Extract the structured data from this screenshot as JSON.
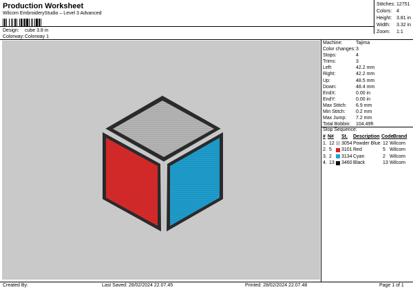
{
  "header": {
    "title": "Production Worksheet",
    "subtitle": "Wilcom EmbroideryStudio – Level 3 Advanced",
    "design_label": "Design:",
    "design_value": "cube 3.8 in",
    "colorway_label": "Colorway:",
    "colorway_value": "Colorway 1"
  },
  "top_stats": [
    {
      "label": "Stitches:",
      "value": "12751"
    },
    {
      "label": "Colors:",
      "value": "4"
    },
    {
      "label": "Height:",
      "value": "3.81 in"
    },
    {
      "label": "Width:",
      "value": "3.32 in"
    },
    {
      "label": "Zoom:",
      "value": "1:1"
    }
  ],
  "machine_info": [
    {
      "label": "Machine:",
      "value": "Tajima"
    },
    {
      "label": "Color changes:",
      "value": "3"
    },
    {
      "label": "Stops:",
      "value": "4"
    },
    {
      "label": "Trims:",
      "value": "3"
    },
    {
      "label": "Left:",
      "value": "42.2 mm"
    },
    {
      "label": "Right:",
      "value": "42.2 mm"
    },
    {
      "label": "Up:",
      "value": "48.5 mm"
    },
    {
      "label": "Down:",
      "value": "48.4 mm"
    },
    {
      "label": "EndX:",
      "value": "0.00 in"
    },
    {
      "label": "EndY:",
      "value": "0.00 in"
    },
    {
      "label": "Max Stitch:",
      "value": "6.9 mm"
    },
    {
      "label": "Min Stitch:",
      "value": "0.2 mm"
    },
    {
      "label": "Max Jump:",
      "value": "7.2 mm"
    },
    {
      "label": "Total Bobbin:",
      "value": "104.49ft"
    }
  ],
  "stop_sequence": {
    "title": "Stop Sequence:",
    "headers": {
      "num": "#",
      "st": "N#",
      "code": "St.",
      "desc": "Description",
      "code2": "Code",
      "brand": "Brand"
    },
    "rows": [
      {
        "num": "1.",
        "st": "12",
        "code": "3054",
        "desc": "Powder Blue",
        "code2": "12",
        "brand": "Wilcom",
        "color": "#c8c8c8"
      },
      {
        "num": "2.",
        "st": "5",
        "code": "3101",
        "desc": "Red",
        "code2": "5",
        "brand": "Wilcom",
        "color": "#e02020"
      },
      {
        "num": "3.",
        "st": "2",
        "code": "3134",
        "desc": "Cyan",
        "code2": "2",
        "brand": "Wilcom",
        "color": "#1fa4d6"
      },
      {
        "num": "4.",
        "st": "13",
        "code": "3460",
        "desc": "Black",
        "code2": "13",
        "brand": "Wilcom",
        "color": "#111111"
      }
    ]
  },
  "footer": {
    "created_by": "Created By:",
    "last_saved": "Last Saved: 28/02/2024 22.07.45",
    "printed": "Printed: 28/02/2024 22.07.48",
    "page": "Page 1 of 1"
  },
  "colors": {
    "top_face": "#b4b4b4",
    "left_face": "#d62a2a",
    "right_face": "#1e9ccc",
    "outline": "#2a2a2a",
    "background": "#c9c9c9"
  }
}
